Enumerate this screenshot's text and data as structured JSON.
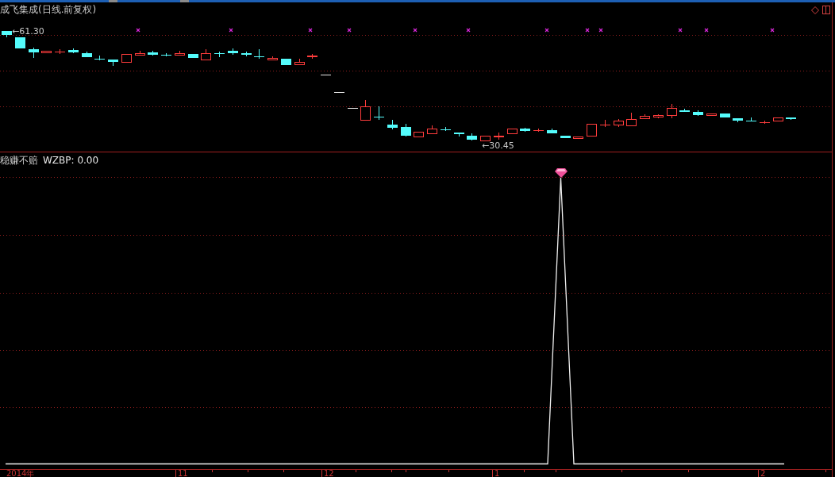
{
  "chart": {
    "title": "成飞集成(日线.前复权)",
    "high_label": "←61.30",
    "low_label": "←30.45"
  },
  "indicator": {
    "name": "稳赚不赔",
    "label": "WZBP: 0.00"
  },
  "time_axis": {
    "labels": [
      "2014年",
      "11",
      "12",
      "1",
      "2"
    ]
  }
}
